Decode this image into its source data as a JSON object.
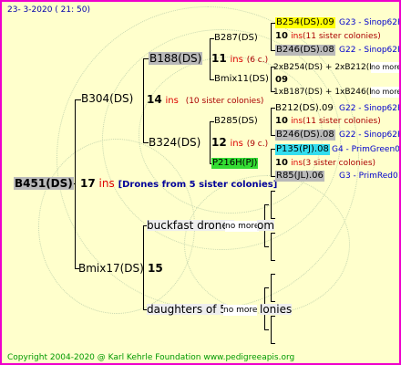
{
  "header": {
    "date": "23-  3-2020  ( 21: 50)"
  },
  "footer": {
    "copyright": "Copyright 2004-2020 @ Karl Kehrle Foundation    www.pedigreeapis.org"
  },
  "root": {
    "name": "B451(DS)",
    "count": "17",
    "ins": "ins",
    "note": "[Drones from 5 sister colonies]"
  },
  "sire": {
    "name": "B304(DS)",
    "count": "14",
    "ins": "ins",
    "note": "(10 sister colonies)",
    "a": {
      "name": "B188(DS)",
      "count": "11",
      "ins": "ins",
      "note": "(6 c.)",
      "a": {
        "name": "B287(DS)"
      },
      "b": {
        "name": "Bmix11(DS)"
      }
    },
    "b": {
      "name": "B324(DS)",
      "count": "12",
      "ins": "ins",
      "note": "(9 c.)",
      "a": {
        "name": "B285(DS)"
      },
      "b": {
        "name": "P216H(PJ)"
      }
    }
  },
  "dam": {
    "name": "Bmix17(DS)",
    "count": "15",
    "a": {
      "name": "buckfast drones",
      "note": "no more",
      "tail": "om"
    },
    "b": {
      "name": "daughters of 5",
      "note": "no more",
      "tail": "lonies"
    }
  },
  "right": {
    "r1": {
      "name": "B254(DS).09",
      "label": "G23 - Sinop62R"
    },
    "r2": {
      "count": "10",
      "ins": "ins",
      "note": "(11 sister colonies)"
    },
    "r3": {
      "name": "B246(DS).08",
      "label": "G22 - Sinop62R"
    },
    "r4": {
      "text": "2xB254(DS) + 2xB212(DS)",
      "more": "no more"
    },
    "r5": {
      "count": "09"
    },
    "r6": {
      "text": "1xB187(DS) + 1xB246(DS)",
      "more": "no more"
    },
    "r7": {
      "name": "B212(DS).09",
      "label": "G22 - Sinop62R"
    },
    "r8": {
      "count": "10",
      "ins": "ins",
      "note": "(11 sister colonies)"
    },
    "r9": {
      "name": "B246(DS).08",
      "label": "G22 - Sinop62R"
    },
    "r10": {
      "name": "P135(PJ).08",
      "label": "G4 - PrimGreen00"
    },
    "r11": {
      "count": "10",
      "ins": "ins",
      "note": "(3 sister colonies)"
    },
    "r12": {
      "name": "R85(JL).06",
      "label": "G3 - PrimRed01"
    }
  }
}
